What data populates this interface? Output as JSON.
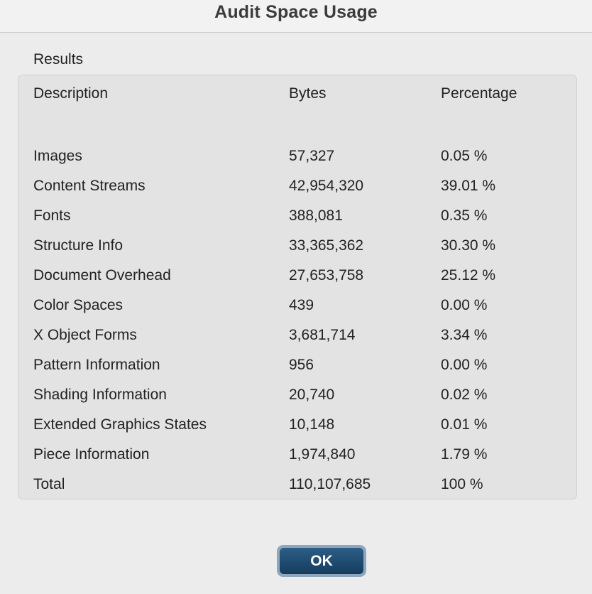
{
  "window": {
    "title": "Audit Space Usage"
  },
  "results": {
    "label": "Results",
    "columns": {
      "description": "Description",
      "bytes": "Bytes",
      "percentage": "Percentage"
    },
    "rows": [
      {
        "description": "Images",
        "bytes": "57,327",
        "percentage": "0.05 %"
      },
      {
        "description": "Content Streams",
        "bytes": "42,954,320",
        "percentage": "39.01 %"
      },
      {
        "description": "Fonts",
        "bytes": "388,081",
        "percentage": "0.35 %"
      },
      {
        "description": "Structure Info",
        "bytes": "33,365,362",
        "percentage": "30.30 %"
      },
      {
        "description": "Document Overhead",
        "bytes": "27,653,758",
        "percentage": "25.12 %"
      },
      {
        "description": "Color Spaces",
        "bytes": "439",
        "percentage": "0.00 %"
      },
      {
        "description": "X Object Forms",
        "bytes": "3,681,714",
        "percentage": "3.34 %"
      },
      {
        "description": "Pattern Information",
        "bytes": "956",
        "percentage": "0.00 %"
      },
      {
        "description": "Shading Information",
        "bytes": "20,740",
        "percentage": "0.02 %"
      },
      {
        "description": "Extended Graphics States",
        "bytes": "10,148",
        "percentage": "0.01 %"
      },
      {
        "description": "Piece Information",
        "bytes": "1,974,840",
        "percentage": "1.79 %"
      },
      {
        "description": "Total",
        "bytes": "110,107,685",
        "percentage": "100 %"
      }
    ]
  },
  "buttons": {
    "ok_label": "OK"
  },
  "colors": {
    "button_fill": "#1f4a70",
    "button_ring": "#8fa7be",
    "panel_background": "#e3e3e3",
    "window_background": "#ececec"
  }
}
